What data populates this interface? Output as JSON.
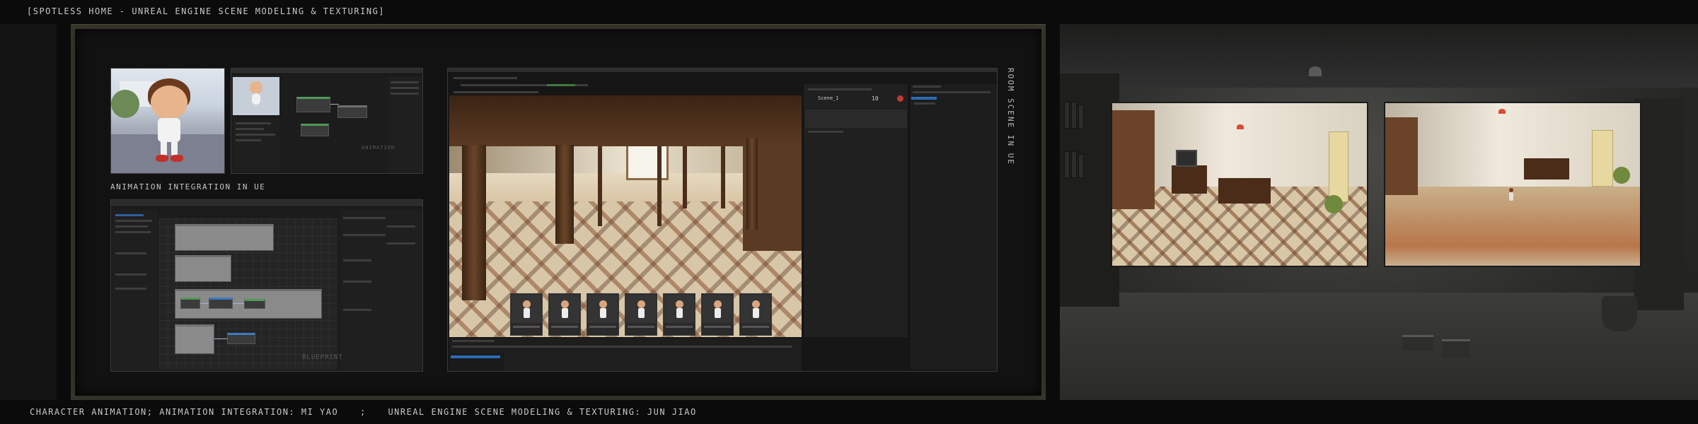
{
  "header": {
    "title": "[SPOTLESS HOME - UNREAL ENGINE SCENE MODELING & TEXTURING]"
  },
  "board": {
    "vertical_label": "ROOM SCENE IN UE",
    "animation_label": "ANIMATION INTEGRATION IN UE",
    "editor_watermark": "ANIMATION",
    "blueprint_watermark": "BLUEPRINT"
  },
  "ue_editor": {
    "scene_name": "Scene_1",
    "frame_value": "10"
  },
  "footer": {
    "left_credit": "CHARACTER ANIMATION; ANIMATION INTEGRATION: MI YAO",
    "separator": ";",
    "right_credit": "UNREAL ENGINE SCENE MODELING & TEXTURING: JUN JIAO"
  },
  "colors": {
    "background": "#0b0b0b",
    "board_glow": "#4c4b36",
    "ue_selection": "#2c6bb5",
    "node_green": "#4f9a56",
    "lamp_red": "#d94a3a"
  }
}
